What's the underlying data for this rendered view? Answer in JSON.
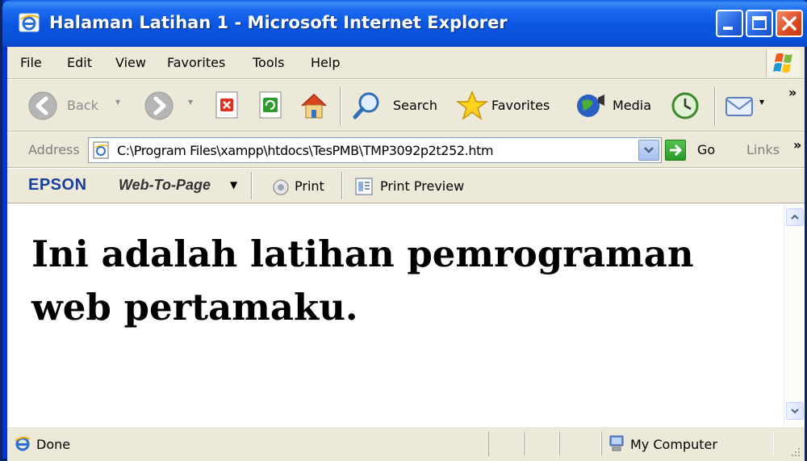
{
  "window": {
    "title": "Halaman Latihan 1 - Microsoft Internet Explorer"
  },
  "menu": {
    "items": [
      "File",
      "Edit",
      "View",
      "Favorites",
      "Tools",
      "Help"
    ]
  },
  "toolbar": {
    "back_label": "Back",
    "search_label": "Search",
    "favorites_label": "Favorites",
    "media_label": "Media",
    "overflow": "»"
  },
  "address": {
    "label": "Address",
    "value": "C:\\Program Files\\xampp\\htdocs\\TesPMB\\TMP3092p2t252.htm",
    "go_label": "Go",
    "links_label": "Links",
    "links_overflow": "»"
  },
  "epson": {
    "logo": "EPSON",
    "web_to_page": "Web-To-Page",
    "print_label": "Print",
    "print_preview_label": "Print Preview"
  },
  "page": {
    "heading": "Ini adalah latihan pemrograman web pertamaku."
  },
  "status": {
    "text": "Done",
    "zone": "My Computer"
  },
  "colors": {
    "titlebar": "#0a55e0",
    "chrome": "#ece9d8",
    "epson_blue": "#1b3f9a"
  },
  "icons": {
    "title": "ie-logo-icon",
    "back": "back-arrow-icon",
    "forward": "forward-arrow-icon",
    "stop": "stop-icon",
    "refresh": "refresh-icon",
    "home": "home-icon",
    "search": "search-icon",
    "favorites": "star-icon",
    "media": "media-icon",
    "history": "history-icon",
    "mail": "mail-icon"
  }
}
